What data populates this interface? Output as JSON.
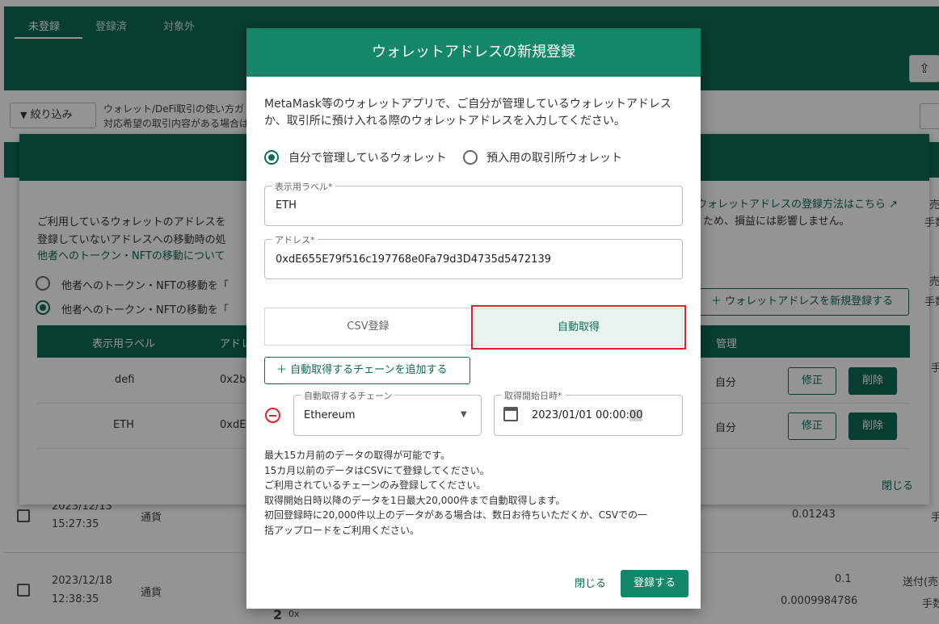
{
  "bg": {
    "tabs": [
      "未登録",
      "登録済",
      "対象外"
    ],
    "upload_icon": "upload-icon",
    "filter_label": "絞り込み",
    "note_lines": [
      "ウォレット/DeFi取引の使い方ガ",
      "対応希望の取引内容がある場合は"
    ],
    "rows": [
      {
        "date": "2023/12/13",
        "time": "15:27:35",
        "type": "通貨",
        "amount": "0.01243",
        "trail": "手"
      },
      {
        "date": "2023/12/18",
        "time": "12:38:35",
        "type": "通貨",
        "amount": "0.1",
        "amount2": "0.0009984786",
        "trail": "送付(売",
        "trail2": "手数"
      }
    ],
    "partial_glyph": "2",
    "partial_glyph2": "0x"
  },
  "mid": {
    "desc_line1": "ご利用しているウォレットのアドレスを",
    "desc_line2": "登録していないアドレスへの移動時の処",
    "desc_link": "他者へのトークン・NFTの移動について",
    "radio1": "他者へのトークン・NFTの移動を「",
    "radio2": "他者へのトークン・NFTの移動を「",
    "help_link": "ウォレットアドレスの登録方法はこちら",
    "help_note": "ため、損益には影響しません。",
    "new_wallet_button": "ウォレットアドレスを新規登録する",
    "columns": {
      "label": "表示用ラベル",
      "address": "アドレ",
      "manage": "管理"
    },
    "rows": [
      {
        "label": "defi",
        "address": "0x2b",
        "manage": "自分",
        "edit": "修正",
        "delete": "削除"
      },
      {
        "label": "ETH",
        "address": "0xdE",
        "manage": "自分",
        "edit": "修正",
        "delete": "削除"
      }
    ],
    "close": "閉じる",
    "side_texts": [
      "売",
      "手数",
      "売",
      "手数",
      "手"
    ]
  },
  "dialog": {
    "title": "ウォレットアドレスの新規登録",
    "intro": "MetaMask等のウォレットアプリで、ご自分が管理しているウォレットアドレスか、取引所に預け入れる際のウォレットアドレスを入力してください。",
    "radio_self": "自分で管理しているウォレット",
    "radio_exchange": "預入用の取引所ウォレット",
    "label_field": {
      "label": "表示用ラベル*",
      "value": "ETH"
    },
    "address_field": {
      "label": "アドレス*",
      "value": "0xdE655E79f516c197768e0Fa79d3D4735d5472139"
    },
    "tab_csv": "CSV登録",
    "tab_auto": "自動取得",
    "add_chain": "自動取得するチェーンを追加する",
    "chain_field": {
      "label": "自動取得するチェーン",
      "value": "Ethereum"
    },
    "start_field": {
      "label": "取得開始日時*",
      "value": "2023/01/01 00:00:",
      "value_sel": "00"
    },
    "notes": [
      "最大15カ月前のデータの取得が可能です。",
      "15カ月以前のデータはCSVにて登録してください。",
      "ご利用されているチェーンのみ登録してください。",
      "取得開始日時以降のデータを1日最大20,000件まで自動取得します。",
      "初回登録時に20,000件以上のデータがある場合は、数日お待ちいただくか、CSVでの一",
      "括アップロードをご利用ください。"
    ],
    "close": "閉じる",
    "submit": "登録する"
  },
  "colors": {
    "brand": "#14876a",
    "brand_dark": "#0e6b55",
    "highlight": "#e0202a"
  }
}
